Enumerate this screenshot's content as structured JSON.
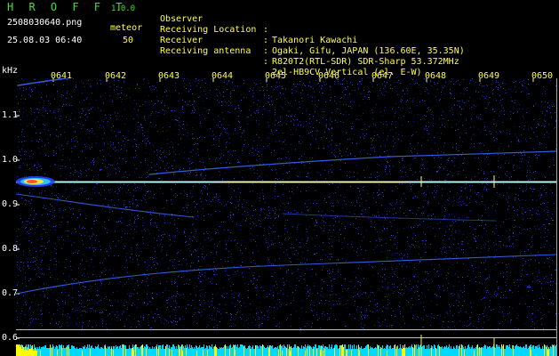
{
  "header": {
    "app_title": "H R O F F T",
    "app_version": "1.0.0",
    "file_name": "2508030640.png",
    "datetime": "25.08.03 06:40",
    "meteor_label": "meteor",
    "meteor_count": "50"
  },
  "info": [
    {
      "key": "Observer",
      "value": "Takanori Kawachi"
    },
    {
      "key": "Receiving Location",
      "value": "Ogaki, Gifu, JAPAN (136.60E, 35.35N)"
    },
    {
      "key": "Receiver",
      "value": "R820T2(RTL-SDR) SDR-Sharp 53.372MHz"
    },
    {
      "key": "Receiving antenna",
      "value": "2el-HB9CV Vertical (el. E-W)"
    }
  ],
  "axis": {
    "unit": "kHz",
    "time_labels": [
      "0641",
      "0642",
      "0643",
      "0644",
      "0645",
      "0646",
      "0647",
      "0648",
      "0649",
      "0650"
    ],
    "freq_labels": [
      "1.1",
      "1.0",
      "0.9",
      "0.8",
      "0.7",
      "0.6"
    ]
  },
  "colors": {
    "title_green": "#32e632",
    "label_yellow": "#ffff40",
    "carrier": "#c8ffff",
    "noise": "#1e3cff",
    "bottom_bar": "#00d8ff",
    "bottom_bar_yellow": "#ffff00"
  }
}
